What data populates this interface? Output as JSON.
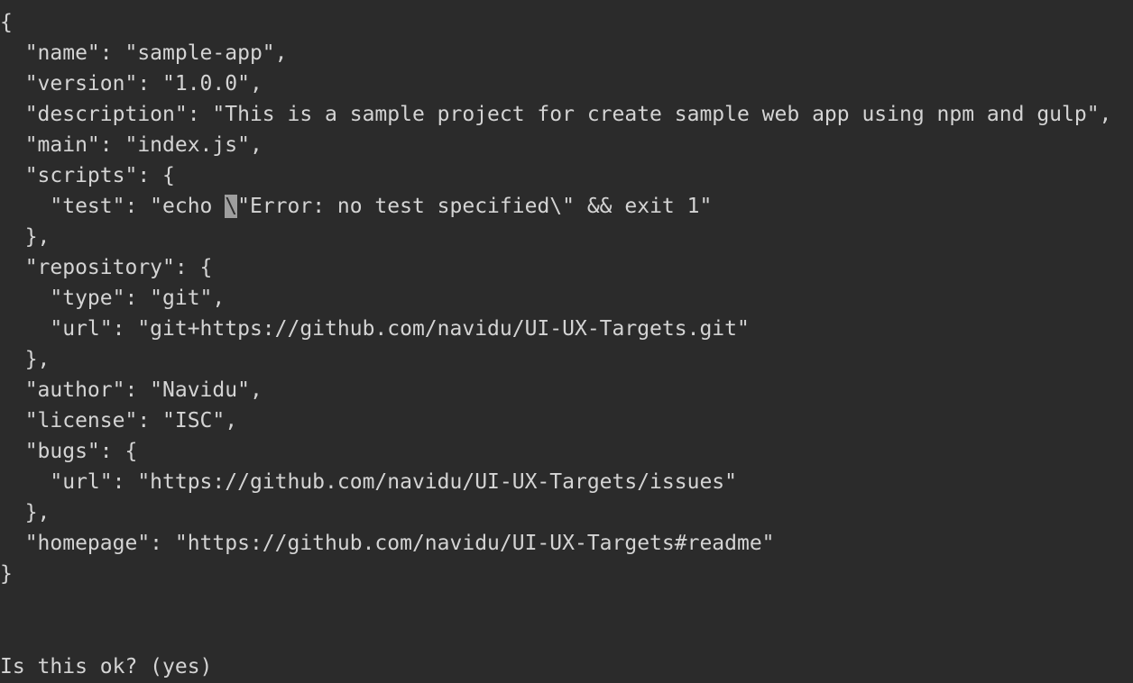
{
  "terminal": {
    "lines": [
      "{",
      "  \"name\": \"sample-app\",",
      "  \"version\": \"1.0.0\",",
      "  \"description\": \"This is a sample project for create sample web app using npm and gulp\",",
      "  \"main\": \"index.js\",",
      "  \"scripts\": {",
      "    \"test\": \"echo ",
      "  },",
      "  \"repository\": {",
      "    \"type\": \"git\",",
      "    \"url\": \"git+https://github.com/navidu/UI-UX-Targets.git\"",
      "  },",
      "  \"author\": \"Navidu\",",
      "  \"license\": \"ISC\",",
      "  \"bugs\": {",
      "    \"url\": \"https://github.com/navidu/UI-UX-Targets/issues\"",
      "  },",
      "  \"homepage\": \"https://github.com/navidu/UI-UX-Targets#readme\"",
      "}"
    ],
    "cursor_char": "\\",
    "cursor_line_after": "\"Error: no test specified\\\" && exit 1\"",
    "prompt": "Is this ok? (yes)"
  }
}
